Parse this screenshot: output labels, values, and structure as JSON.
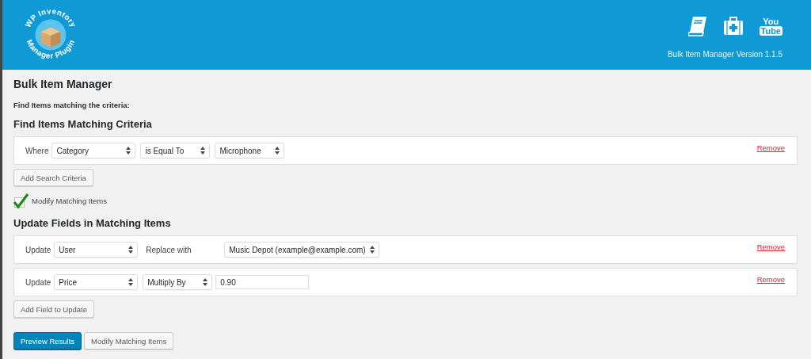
{
  "header": {
    "logo_text_top": "WP Inventory",
    "logo_text_bottom": "Manager Plugin",
    "icons": [
      {
        "kind": "book"
      },
      {
        "kind": "firstaid"
      },
      {
        "kind": "youtube",
        "top": "You",
        "bottom": "Tube"
      }
    ],
    "version": "Bulk Item Manager Version 1.1.5"
  },
  "page_title": "Bulk Item Manager",
  "intro": "Find Items matching the criteria:",
  "criteria": {
    "heading": "Find Items Matching Criteria",
    "rows": [
      {
        "label": "Where",
        "remove": "Remove",
        "fields": [
          {
            "kind": "select",
            "value": "Category"
          },
          {
            "kind": "select",
            "value": "is Equal To"
          },
          {
            "kind": "select",
            "value": "Microphone"
          }
        ]
      }
    ],
    "add_button": "Add Search Criteria"
  },
  "modify_toggle": {
    "label": "Modify Matching Items",
    "checked": true
  },
  "updates": {
    "heading": "Update Fields in Matching Items",
    "rows": [
      {
        "label": "Update",
        "remove": "Remove",
        "fields": [
          {
            "kind": "select",
            "value": "User"
          },
          {
            "kind": "text",
            "value": "Replace with"
          },
          {
            "kind": "select",
            "value": "Music Depot (example@example.com)"
          }
        ]
      },
      {
        "label": "Update",
        "remove": "Remove",
        "fields": [
          {
            "kind": "select",
            "value": "Price"
          },
          {
            "kind": "select",
            "value": "Multiply By"
          },
          {
            "kind": "input",
            "value": "0.90"
          }
        ]
      }
    ],
    "add_button": "Add Field to Update"
  },
  "actions": [
    {
      "label": "Preview Results",
      "primary": true
    },
    {
      "label": "Modify Matching Items",
      "primary": false
    }
  ]
}
